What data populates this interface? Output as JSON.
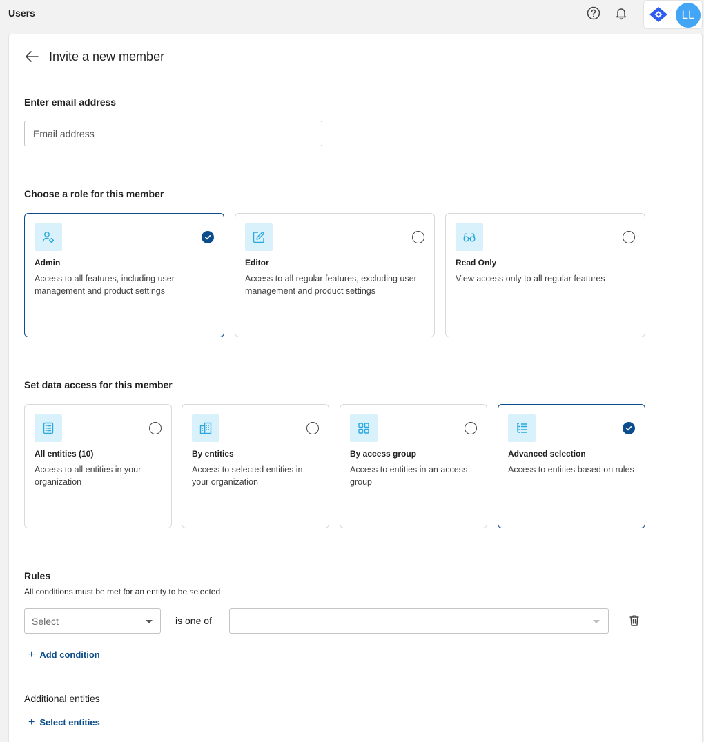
{
  "topbar": {
    "title": "Users",
    "icons": [
      "help-icon",
      "bell-icon",
      "brand-logo"
    ],
    "avatar_initials": "LL",
    "avatar_color": "#42a5f5"
  },
  "page": {
    "title": "Invite a new member"
  },
  "email": {
    "label": "Enter email address",
    "placeholder": "Email address",
    "value": ""
  },
  "role": {
    "label": "Choose a role for this member",
    "options": [
      {
        "title": "Admin",
        "description": "Access to all features, including user management and product settings",
        "icon": "user-gear-icon",
        "selected": true
      },
      {
        "title": "Editor",
        "description": "Access to all regular features, excluding user management and product settings",
        "icon": "edit-icon",
        "selected": false
      },
      {
        "title": "Read Only",
        "description": "View access only to all regular features",
        "icon": "glasses-icon",
        "selected": false
      }
    ]
  },
  "access": {
    "label": "Set data access for this member",
    "options": [
      {
        "title": "All entities (10)",
        "description": "Access to all entities in your organization",
        "icon": "list-icon",
        "selected": false
      },
      {
        "title": "By entities",
        "description": "Access to selected entities in your organization",
        "icon": "building-icon",
        "selected": false
      },
      {
        "title": "By access group",
        "description": "Access to entities in an access group",
        "icon": "grid-icon",
        "selected": false
      },
      {
        "title": "Advanced selection",
        "description": "Access to entities based on rules",
        "icon": "tree-list-icon",
        "selected": true
      }
    ]
  },
  "rules": {
    "title": "Rules",
    "hint": "All conditions must be met for an entity to be selected",
    "field_select": "Select",
    "operator": "is one of",
    "value_select": "",
    "add_condition": "Add condition"
  },
  "additional": {
    "title": "Additional entities",
    "select_entities": "Select entities"
  },
  "colors": {
    "accent": "#0b4d8c",
    "icon_bg": "#d9f1fb",
    "icon_fg": "#29a8e0"
  }
}
